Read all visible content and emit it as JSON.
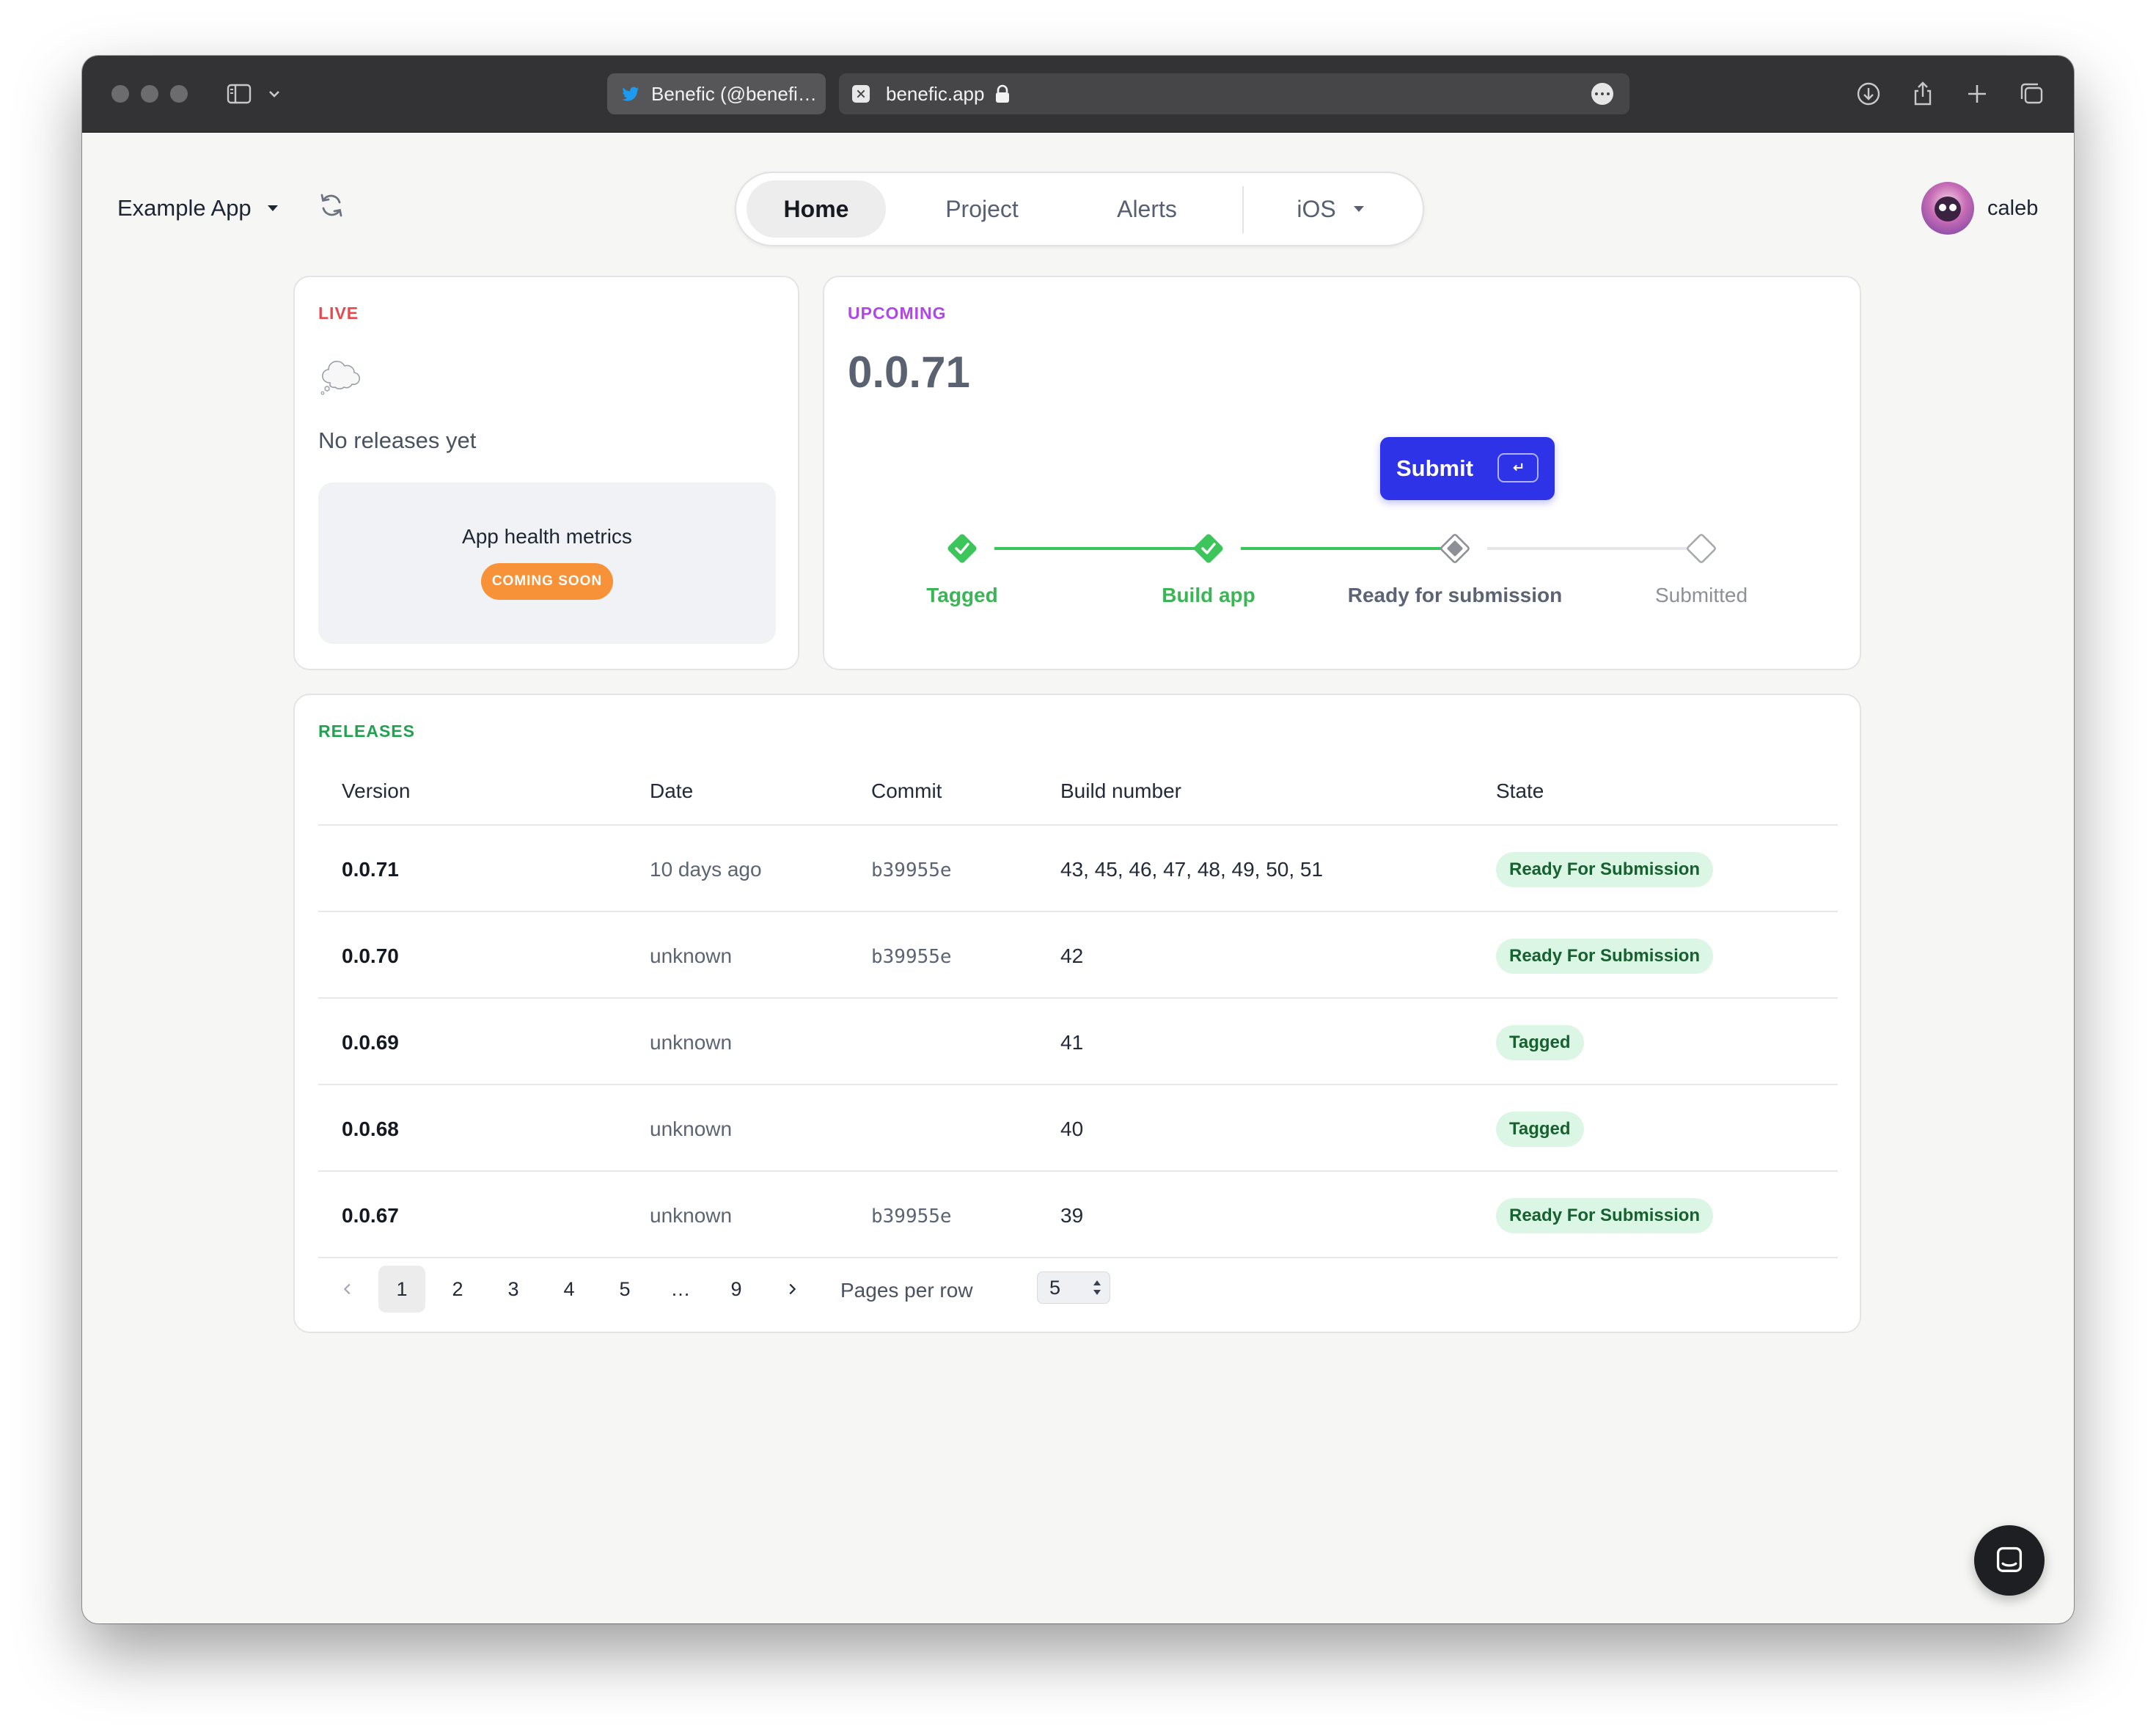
{
  "browser": {
    "tabs": [
      {
        "title": "Benefic (@benefi…",
        "favicon": "twitter-bird-icon"
      },
      {
        "title": "benefic.app",
        "favicon": "benefic-logo-icon"
      }
    ]
  },
  "header": {
    "app_name": "Example App",
    "nav": [
      {
        "label": "Home",
        "active": true
      },
      {
        "label": "Project",
        "active": false
      },
      {
        "label": "Alerts",
        "active": false
      },
      {
        "label": "iOS",
        "active": false
      }
    ],
    "user_name": "caleb"
  },
  "live": {
    "label": "LIVE",
    "empty_text": "No releases yet",
    "health_title": "App health metrics",
    "health_badge": "COMING SOON"
  },
  "upcoming": {
    "label": "UPCOMING",
    "version": "0.0.71",
    "submit_label": "Submit",
    "steps": [
      {
        "label": "Tagged",
        "status": "done"
      },
      {
        "label": "Build app",
        "status": "done"
      },
      {
        "label": "Ready for submission",
        "status": "current"
      },
      {
        "label": "Submitted",
        "status": "pending"
      }
    ]
  },
  "releases": {
    "label": "RELEASES",
    "columns": [
      "Version",
      "Date",
      "Commit",
      "Build number",
      "State"
    ],
    "rows": [
      {
        "version": "0.0.71",
        "date": "10 days ago",
        "commit": "b39955e",
        "builds": "43, 45, 46, 47, 48, 49, 50, 51",
        "state": "Ready For Submission"
      },
      {
        "version": "0.0.70",
        "date": "unknown",
        "commit": "b39955e",
        "builds": "42",
        "state": "Ready For Submission"
      },
      {
        "version": "0.0.69",
        "date": "unknown",
        "commit": "",
        "builds": "41",
        "state": "Tagged"
      },
      {
        "version": "0.0.68",
        "date": "unknown",
        "commit": "",
        "builds": "40",
        "state": "Tagged"
      },
      {
        "version": "0.0.67",
        "date": "unknown",
        "commit": "b39955e",
        "builds": "39",
        "state": "Ready For Submission"
      }
    ],
    "pagination": {
      "pages": [
        "1",
        "2",
        "3",
        "4",
        "5",
        "…",
        "9"
      ],
      "current": "1",
      "per_page_label": "Pages per row",
      "per_page_value": "5"
    }
  },
  "colors": {
    "live": "#e5484d",
    "upcoming": "#b146e8",
    "releases": "#22a150",
    "step_done": "#3cc55b",
    "step_current": "#8d9096",
    "submit": "#2f33e8",
    "badge_bg": "#dcf6e5"
  }
}
